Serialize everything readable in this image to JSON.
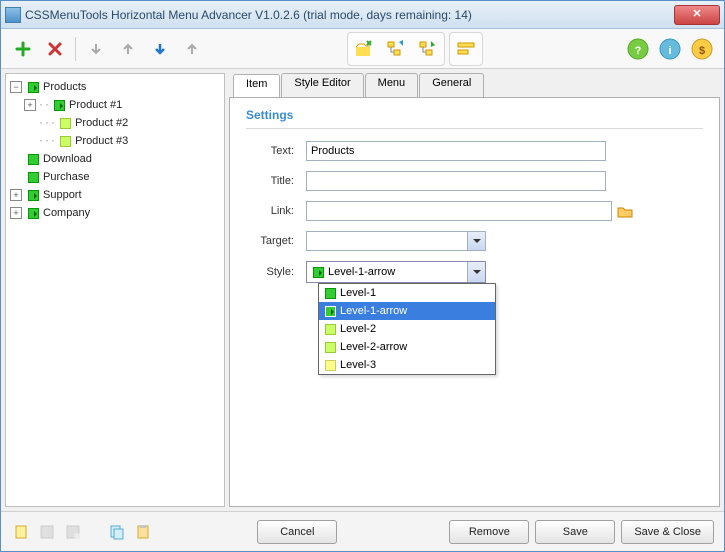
{
  "window": {
    "title": "CSSMenuTools Horizontal Menu Advancer V1.0.2.6 (trial mode, days remaining: 14)"
  },
  "tree": {
    "root": "Products",
    "children": [
      "Product #1",
      "Product #2",
      "Product #3"
    ],
    "siblings": [
      "Download",
      "Purchase",
      "Support",
      "Company"
    ]
  },
  "tabs": {
    "item": "Item",
    "style_editor": "Style Editor",
    "menu": "Menu",
    "general": "General"
  },
  "section": {
    "settings": "Settings"
  },
  "form": {
    "text_label": "Text:",
    "text_value": "Products",
    "title_label": "Title:",
    "title_value": "",
    "link_label": "Link:",
    "link_value": "",
    "target_label": "Target:",
    "target_value": "",
    "style_label": "Style:",
    "style_value": "Level-1-arrow"
  },
  "style_options": {
    "opt1": "Level-1",
    "opt2": "Level-1-arrow",
    "opt3": "Level-2",
    "opt4": "Level-2-arrow",
    "opt5": "Level-3"
  },
  "buttons": {
    "cancel": "Cancel",
    "remove": "Remove",
    "save": "Save",
    "save_close": "Save & Close"
  }
}
